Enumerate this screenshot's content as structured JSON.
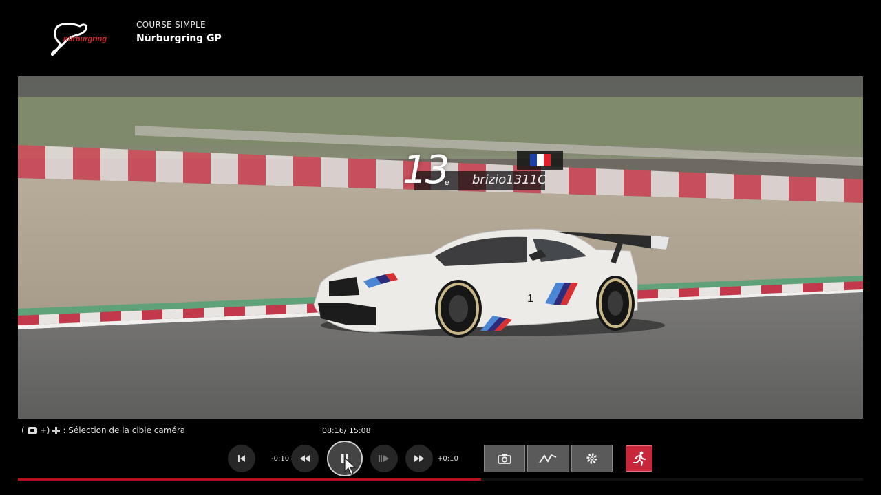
{
  "header": {
    "logo_text": "nürburgring",
    "mode": "COURSE SIMPLE",
    "track": "Nürburgring GP"
  },
  "overlay": {
    "position": "13",
    "position_suffix": "e",
    "driver_name": "brizio1311C",
    "flag_colors": [
      "#1f3fa8",
      "#ffffff",
      "#e0202a"
    ]
  },
  "controls": {
    "camera_hint_open": "(",
    "camera_hint_plus": "+)",
    "camera_hint_text": ": Sélection de la cible caméra",
    "time": "08:16/ 15:08",
    "rewind_label": "-0:10",
    "forward_label": "+0:10",
    "progress": 0.548
  },
  "icons": {
    "prev": "skip-start-icon",
    "rewind": "rewind-icon",
    "pause": "pause-icon",
    "step": "frame-step-icon",
    "forward": "fast-forward-icon",
    "camera": "camera-icon",
    "telemetry": "chart-line-icon",
    "settings": "gear-icon",
    "exit": "exit-runner-icon"
  },
  "colors": {
    "accent_red": "#c8263a",
    "progress_red": "#b3111f"
  }
}
